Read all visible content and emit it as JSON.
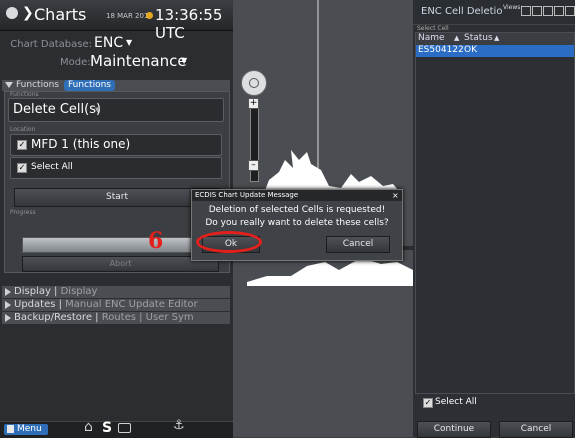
{
  "header": {
    "app_title": "Charts",
    "date": "18 MAR 2015",
    "time": "13:36:55 UTC"
  },
  "chart_db": {
    "db_label": "Chart Database:",
    "db_value": "ENC",
    "mode_label": "Mode:",
    "mode_value": "Maintenance"
  },
  "functions": {
    "section_label": "Functions",
    "tab_label": "Functions",
    "sub_label": "Functions",
    "selected": "Delete Cell(s)",
    "location_label": "Location",
    "location_value": "MFD 1 (this one)",
    "select_all": "Select All",
    "start_label": "Start",
    "progress_label": "Progress",
    "abort_label": "Abort"
  },
  "sections": [
    {
      "name": "Display",
      "rest": "Display"
    },
    {
      "name": "Updates",
      "rest": "Manual ENC Update Editor"
    },
    {
      "name": "Backup/Restore",
      "rest": "Routes | User Sym"
    }
  ],
  "bottom_bar": {
    "menu_label": "Menu",
    "s_label": "S"
  },
  "annotation": {
    "step_number": "6"
  },
  "dialog": {
    "title": "ECDIS Chart Update Message",
    "close": "×",
    "line1": "Deletion of selected Cells is requested!",
    "line2": "Do you really want to delete these cells?",
    "ok_label": "Ok",
    "cancel_label": "Cancel"
  },
  "right_panel": {
    "title": "ENC Cell Deletio",
    "views_label": "Views:",
    "select_cell_label": "Select Cell",
    "col_name": "Name",
    "col_status": "Status",
    "rows": [
      {
        "name": "ES504122",
        "status": "OK"
      }
    ],
    "select_all": "Select All",
    "continue_label": "Continue",
    "cancel_label": "Cancel"
  },
  "colors": {
    "accent_blue": "#2f6fb8",
    "highlight_row": "#2b6cc4",
    "annotation_red": "#e3201b"
  }
}
